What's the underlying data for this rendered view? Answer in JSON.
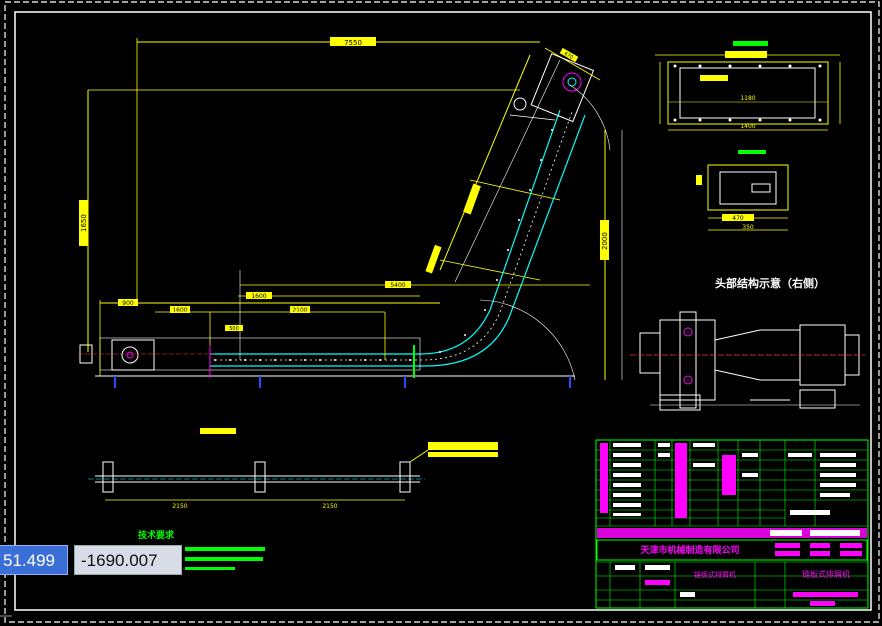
{
  "drawing": {
    "title": "头部结构示意（右侧）",
    "section_title": "技术要求",
    "company": "天津市机械制造有限公司",
    "tb_name_left": "链板式排屑机",
    "tb_name_right": "链板式排屑机",
    "dims": {
      "top_length": "7550",
      "slant_width": "670",
      "height_left": "1650",
      "height_right": "2000",
      "bottom_total": "5400",
      "bottom_mid": "1600",
      "seg_a": "900",
      "seg_b": "1600",
      "seg_c": "2100",
      "seg_d": "500",
      "span_left": "2150",
      "span_right": "2150",
      "top_plan_overall": "1400",
      "top_plan_inner": "1180",
      "small_box_width": "470",
      "small_box_height": "350"
    }
  },
  "cursor_coords": {
    "x": "51.499",
    "y": "-1690.007"
  },
  "colors": {
    "background": "#000000",
    "yellow": "#ffff00",
    "white": "#ffffff",
    "green": "#00ff00",
    "magenta": "#ff00ff",
    "cyan": "#00ffff",
    "blue": "#2a4bff",
    "red": "#ff3030"
  }
}
